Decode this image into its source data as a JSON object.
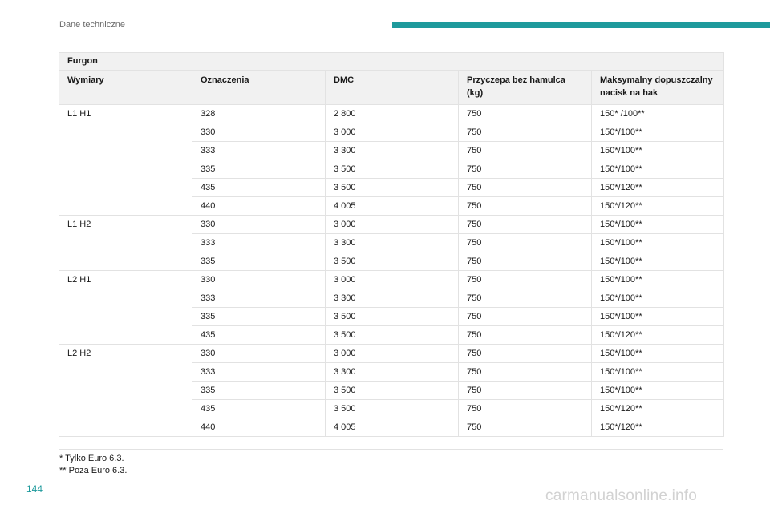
{
  "header": {
    "section": "Dane techniczne",
    "accent_color": "#1e9a9c"
  },
  "table": {
    "title": "Furgon",
    "columns": [
      "Wymiary",
      "Oznaczenia",
      "DMC",
      "Przyczepa bez hamulca (kg)",
      "Maksymalny dopuszczalny nacisk na hak"
    ],
    "rows": [
      [
        "L1 H1",
        "328",
        "2 800",
        "750",
        "150* /100**"
      ],
      [
        "",
        "330",
        "3 000",
        "750",
        "150*/100**"
      ],
      [
        "",
        "333",
        "3 300",
        "750",
        "150*/100**"
      ],
      [
        "",
        "335",
        "3 500",
        "750",
        "150*/100**"
      ],
      [
        "",
        "435",
        "3 500",
        "750",
        "150*/120**"
      ],
      [
        "",
        "440",
        "4 005",
        "750",
        "150*/120**"
      ],
      [
        "L1 H2",
        "330",
        "3 000",
        "750",
        "150*/100**"
      ],
      [
        "",
        "333",
        "3 300",
        "750",
        "150*/100**"
      ],
      [
        "",
        "335",
        "3 500",
        "750",
        "150*/100**"
      ],
      [
        "L2 H1",
        "330",
        "3 000",
        "750",
        "150*/100**"
      ],
      [
        "",
        "333",
        "3 300",
        "750",
        "150*/100**"
      ],
      [
        "",
        "335",
        "3 500",
        "750",
        "150*/100**"
      ],
      [
        "",
        "435",
        "3 500",
        "750",
        "150*/120**"
      ],
      [
        "L2 H2",
        "330",
        "3 000",
        "750",
        "150*/100**"
      ],
      [
        "",
        "333",
        "3 300",
        "750",
        "150*/100**"
      ],
      [
        "",
        "335",
        "3 500",
        "750",
        "150*/100**"
      ],
      [
        "",
        "435",
        "3 500",
        "750",
        "150*/120**"
      ],
      [
        "",
        "440",
        "4 005",
        "750",
        "150*/120**"
      ]
    ]
  },
  "footnotes": [
    "* Tylko Euro 6.3.",
    "** Poza Euro 6.3."
  ],
  "page_number": "144",
  "watermark": "carmanualsonline.info"
}
